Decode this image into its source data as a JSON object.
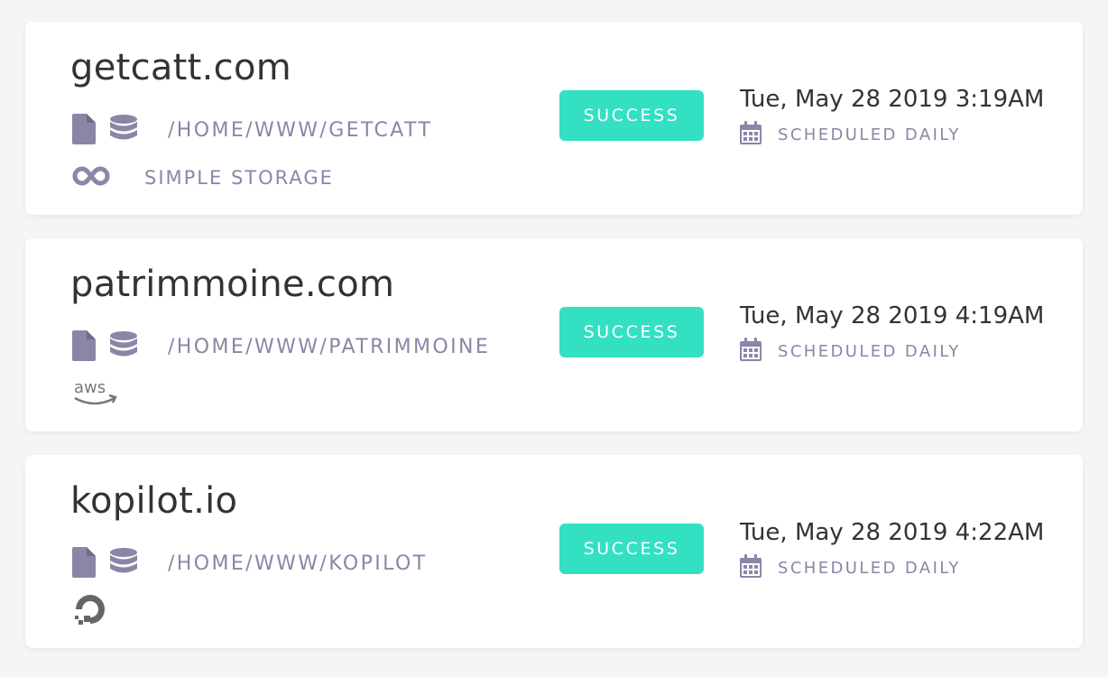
{
  "colors": {
    "background": "#f5f5f5",
    "card": "#ffffff",
    "success": "#33e0c2",
    "muted": "#8a86a6",
    "text": "#333333"
  },
  "backups": [
    {
      "site": "getcatt.com",
      "path": "/HOME/WWW/GETCATT",
      "provider": {
        "icon": "infinity-icon",
        "label": "SIMPLE STORAGE"
      },
      "status": "SUCCESS",
      "timestamp": "Tue, May 28 2019 3:19AM",
      "schedule": "SCHEDULED DAILY"
    },
    {
      "site": "patrimmoine.com",
      "path": "/HOME/WWW/PATRIMMOINE",
      "provider": {
        "icon": "aws-logo-icon",
        "label": "aws"
      },
      "status": "SUCCESS",
      "timestamp": "Tue, May 28 2019 4:19AM",
      "schedule": "SCHEDULED DAILY"
    },
    {
      "site": "kopilot.io",
      "path": "/HOME/WWW/KOPILOT",
      "provider": {
        "icon": "digitalocean-logo-icon",
        "label": ""
      },
      "status": "SUCCESS",
      "timestamp": "Tue, May 28 2019 4:22AM",
      "schedule": "SCHEDULED DAILY"
    }
  ]
}
